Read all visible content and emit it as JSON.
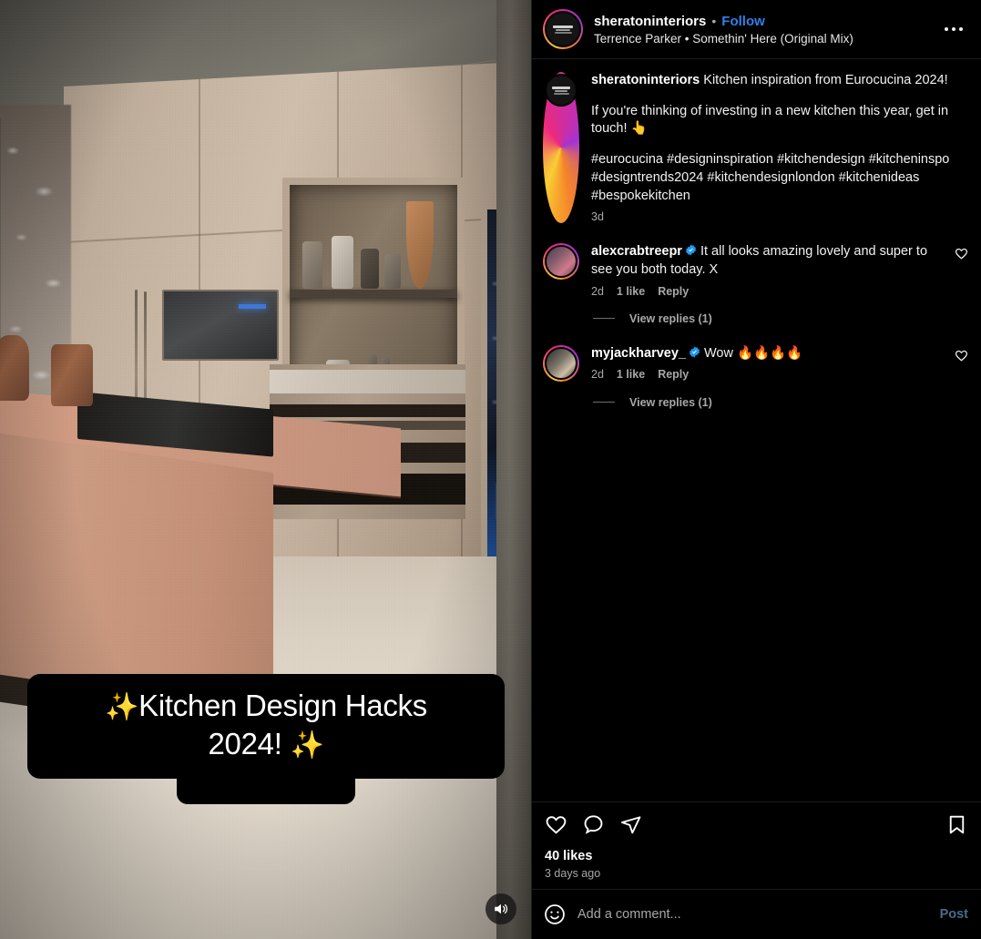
{
  "post": {
    "header": {
      "username": "sheratoninteriors",
      "separator": "•",
      "follow_label": "Follow",
      "audio_track": "Terrence Parker • Somethin' Here (Original Mix)",
      "more_icon": "more-options-icon",
      "avatar_ring_colors": [
        "#f58529",
        "#ee2a7b",
        "#a134d4",
        "#f9ce34"
      ]
    },
    "caption": {
      "username": "sheratoninteriors",
      "line1": "Kitchen inspiration from Eurocucina 2024!",
      "line2": "If you're thinking of investing in a new kitchen this year, get in touch! 👆",
      "line3": "#eurocucina #designinspiration #kitchendesign #kitcheninspo #designtrends2024 #kitchendesignlondon #kitchenideas #bespokekitchen",
      "timestamp": "3d"
    },
    "comments": [
      {
        "username": "alexcrabtreepr",
        "verified": true,
        "text": "It all looks amazing lovely and super to see you both today. X",
        "time": "2d",
        "likes": "1 like",
        "reply_label": "Reply",
        "view_replies": "View replies (1)"
      },
      {
        "username": "myjackharvey_",
        "verified": true,
        "text": "Wow 🔥🔥🔥🔥",
        "time": "2d",
        "likes": "1 like",
        "reply_label": "Reply",
        "view_replies": "View replies (1)"
      }
    ],
    "actions": {
      "like_icon": "heart-icon",
      "comment_icon": "comment-bubble-icon",
      "share_icon": "share-paper-plane-icon",
      "save_icon": "bookmark-icon",
      "likes_count": "40 likes",
      "posted_ago": "3 days ago"
    },
    "compose": {
      "emoji_icon": "emoji-smiley-icon",
      "placeholder": "Add a comment...",
      "post_label": "Post"
    }
  },
  "video": {
    "overlay_line1_spark": "✨",
    "overlay_line1": "Kitchen Design Hacks",
    "overlay_line2": "2024! ",
    "overlay_line2_spark": "✨",
    "sound_icon": "sound-on-icon"
  },
  "colors": {
    "background": "#000000",
    "follow_blue": "#2f7fe8",
    "post_blue": "#4a6b8a",
    "verified_blue": "#1d9bf0",
    "muted_text": "#a8a8a8",
    "primary_text": "#f2f2f2",
    "caption_accent": "#ffc83d"
  }
}
